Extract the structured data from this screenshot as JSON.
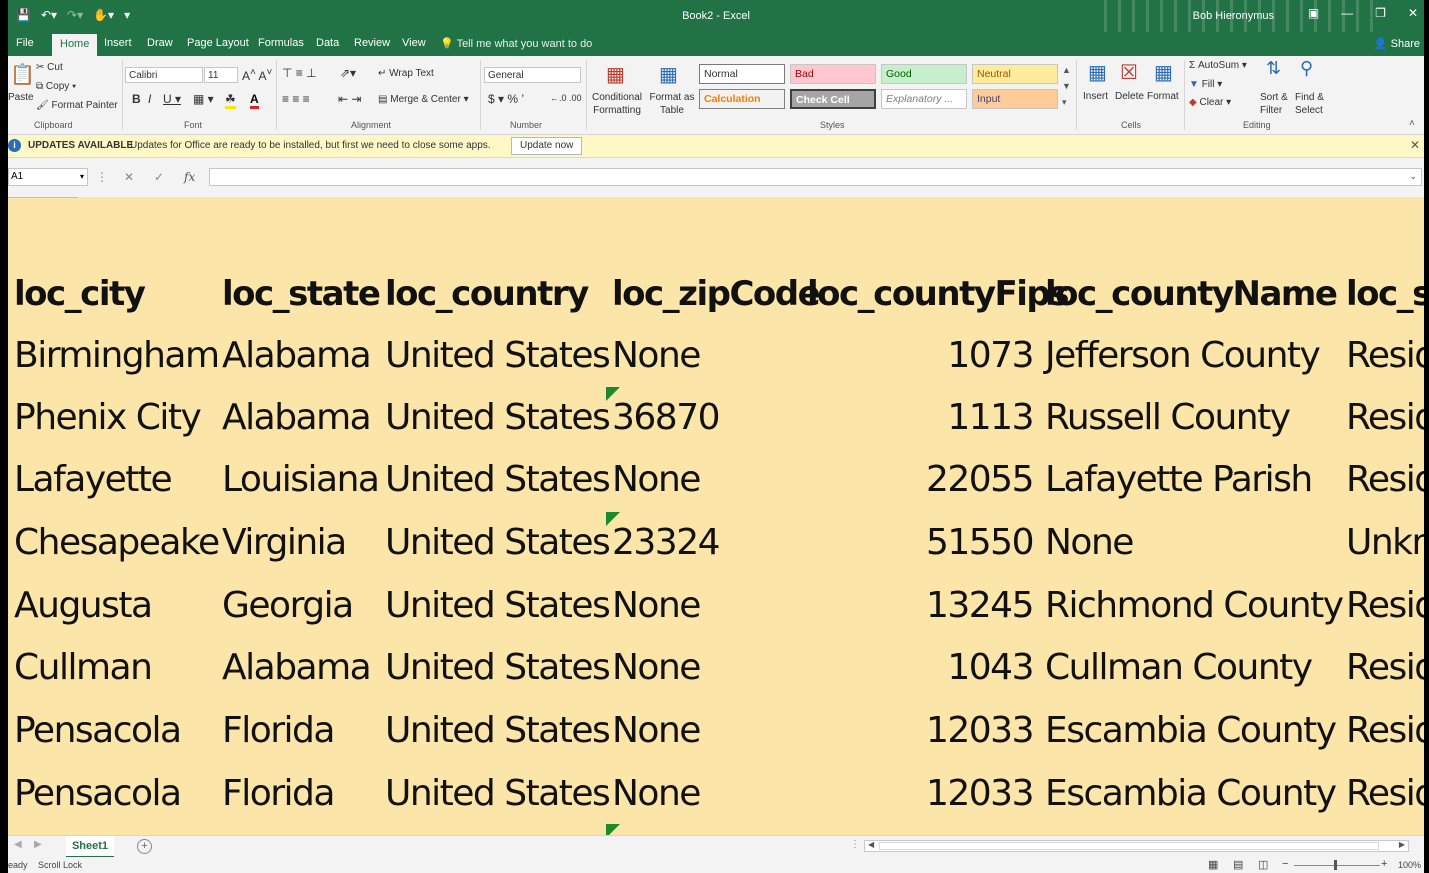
{
  "window": {
    "title": "Book2  -  Excel",
    "user": "Bob Hieronymus"
  },
  "tabs": [
    "File",
    "Home",
    "Insert",
    "Draw",
    "Page Layout",
    "Formulas",
    "Data",
    "Review",
    "View"
  ],
  "tell_me": "Tell me what you want to do",
  "share": "Share",
  "ribbon": {
    "clipboard": {
      "paste": "Paste",
      "cut": "Cut",
      "copy": "Copy",
      "format_painter": "Format Painter",
      "label": "Clipboard"
    },
    "font": {
      "name": "Calibri",
      "size": "11",
      "label": "Font"
    },
    "alignment": {
      "wrap_text": "Wrap Text",
      "merge_center": "Merge & Center",
      "label": "Alignment"
    },
    "number": {
      "format": "General",
      "label": "Number"
    },
    "styles": {
      "conditional": "Conditional Formatting",
      "format_table": "Format as Table",
      "normal": "Normal",
      "bad": "Bad",
      "good": "Good",
      "neutral": "Neutral",
      "calculation": "Calculation",
      "check_cell": "Check Cell",
      "explanatory": "Explanatory ...",
      "input": "Input",
      "label": "Styles"
    },
    "cells": {
      "insert": "Insert",
      "delete": "Delete",
      "format": "Format",
      "label": "Cells"
    },
    "editing": {
      "autosum": "AutoSum",
      "fill": "Fill",
      "clear": "Clear",
      "sort_filter": "Sort & Filter",
      "find_select": "Find & Select",
      "label": "Editing"
    }
  },
  "update_bar": {
    "title": "UPDATES AVAILABLE",
    "message": "Updates for Office are ready to be installed, but first we need to close some apps.",
    "button": "Update now"
  },
  "formula_bar": {
    "name_box": "A1",
    "fx": "fx",
    "value": ""
  },
  "sheet": {
    "headers": [
      "loc_city",
      "loc_state",
      "loc_country",
      "loc_zipCode",
      "loc_countyFips",
      "loc_countyName",
      "loc_s"
    ],
    "rows": [
      [
        "Birmingham",
        "Alabama",
        "United States",
        "None",
        "1073",
        "Jefferson County",
        "Resid"
      ],
      [
        "Phenix City",
        "Alabama",
        "United States",
        "36870",
        "1113",
        "Russell County",
        "Resid"
      ],
      [
        "Lafayette",
        "Louisiana",
        "United States",
        "None",
        "22055",
        "Lafayette Parish",
        "Resid"
      ],
      [
        "Chesapeake",
        "Virginia",
        "United States",
        "23324",
        "51550",
        "None",
        "Unkn"
      ],
      [
        "Augusta",
        "Georgia",
        "United States",
        "None",
        "13245",
        "Richmond County",
        "Resid"
      ],
      [
        "Cullman",
        "Alabama",
        "United States",
        "None",
        "1043",
        "Cullman County",
        "Resid"
      ],
      [
        "Pensacola",
        "Florida",
        "United States",
        "None",
        "12033",
        "Escambia County",
        "Resid"
      ],
      [
        "Pensacola",
        "Florida",
        "United States",
        "None",
        "12033",
        "Escambia County",
        "Resid"
      ]
    ]
  },
  "sheet_tab": "Sheet1",
  "status": {
    "ready": "eady",
    "scroll_lock": "Scroll Lock",
    "zoom": "100%"
  }
}
